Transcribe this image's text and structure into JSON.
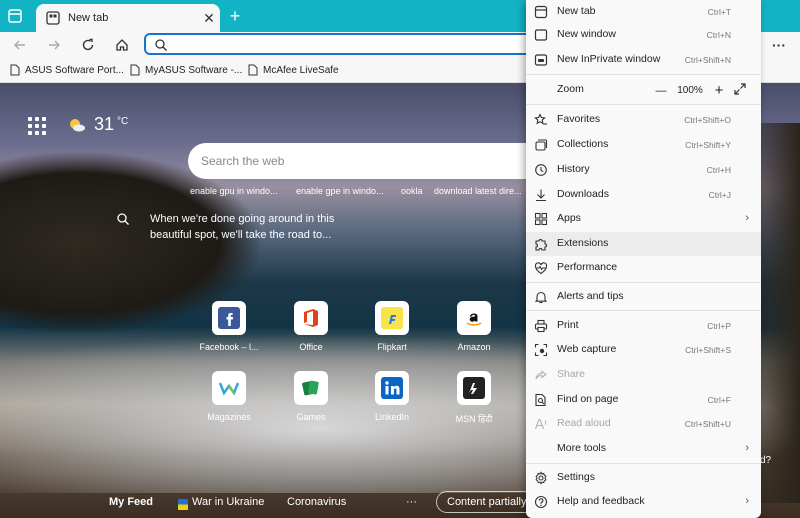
{
  "browser": {
    "tab_title": "New tab",
    "tab_close": "✕",
    "new_tab_symbol": "+",
    "more_symbol": "···",
    "accent": "#12b3c4"
  },
  "bookmarks": [
    {
      "label": "ASUS Software Port..."
    },
    {
      "label": "MyASUS Software -..."
    },
    {
      "label": "McAfee LiveSafe"
    }
  ],
  "newtab": {
    "weather": {
      "temp": "31",
      "unit": "°C"
    },
    "search_placeholder": "Search the web",
    "suggestions": [
      "enable gpu in windo...",
      "enable gpe in windo...",
      "ookla",
      "download latest dire..."
    ],
    "promo_text": "When we're done going around in this beautiful spot, we'll take the road to...",
    "tiles": [
      {
        "label": "Facebook – l...",
        "icon": "facebook-icon"
      },
      {
        "label": "Office",
        "icon": "office-icon"
      },
      {
        "label": "Flipkart",
        "icon": "flipkart-icon"
      },
      {
        "label": "Amazon",
        "icon": "amazon-icon"
      },
      {
        "label": "Magazines",
        "icon": "magazines-icon"
      },
      {
        "label": "Games",
        "icon": "games-icon"
      },
      {
        "label": "LinkedIn",
        "icon": "linkedin-icon"
      },
      {
        "label": "MSN हिंदी",
        "icon": "msn-icon"
      }
    ],
    "feed": {
      "my_feed": "My Feed",
      "war": "War in Ukraine",
      "corona": "Coronavirus",
      "dots": "···",
      "content": "Content partially",
      "qmark": "d?"
    }
  },
  "menu": {
    "new_tab": {
      "label": "New tab",
      "shortcut": "Ctrl+T"
    },
    "new_window": {
      "label": "New window",
      "shortcut": "Ctrl+N"
    },
    "inprivate": {
      "label": "New InPrivate window",
      "shortcut": "Ctrl+Shift+N"
    },
    "zoom": {
      "label": "Zoom",
      "minus": "—",
      "value": "100%",
      "plus": "+"
    },
    "favorites": {
      "label": "Favorites",
      "shortcut": "Ctrl+Shift+O"
    },
    "collections": {
      "label": "Collections",
      "shortcut": "Ctrl+Shift+Y"
    },
    "history": {
      "label": "History",
      "shortcut": "Ctrl+H"
    },
    "downloads": {
      "label": "Downloads",
      "shortcut": "Ctrl+J"
    },
    "apps": {
      "label": "Apps",
      "chevron": "›"
    },
    "extensions": {
      "label": "Extensions"
    },
    "performance": {
      "label": "Performance"
    },
    "alerts": {
      "label": "Alerts and tips"
    },
    "print": {
      "label": "Print",
      "shortcut": "Ctrl+P"
    },
    "web_capture": {
      "label": "Web capture",
      "shortcut": "Ctrl+Shift+S"
    },
    "share": {
      "label": "Share"
    },
    "find": {
      "label": "Find on page",
      "shortcut": "Ctrl+F"
    },
    "read_aloud": {
      "label": "Read aloud",
      "shortcut": "Ctrl+Shift+U"
    },
    "more_tools": {
      "label": "More tools",
      "chevron": "›"
    },
    "settings": {
      "label": "Settings"
    },
    "help": {
      "label": "Help and feedback",
      "chevron": "›"
    }
  }
}
